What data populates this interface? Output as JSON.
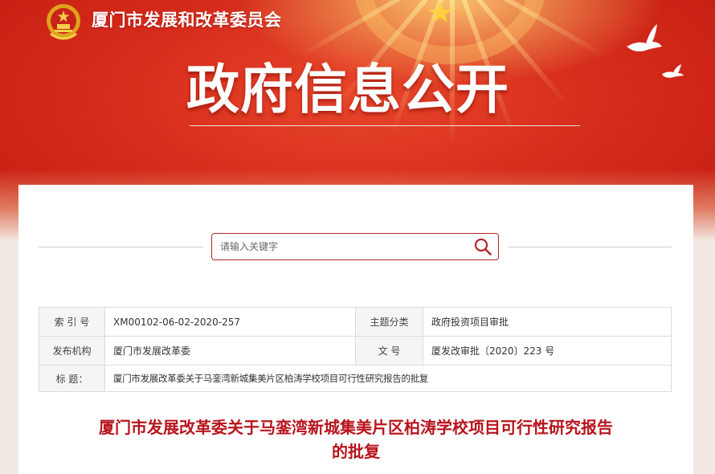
{
  "header": {
    "org_name": "厦门市发展和改革委员会",
    "page_heading": "政府信息公开"
  },
  "search": {
    "placeholder": "请输入关键字"
  },
  "meta": {
    "index_label": "索 引 号",
    "index_value": "XM00102-06-02-2020-257",
    "topic_label": "主题分类",
    "topic_value": "政府投资项目审批",
    "publisher_label": "发布机构",
    "publisher_value": "厦门市发展改革委",
    "docno_label": "文      号",
    "docno_value": "厦发改审批〔2020〕223 号",
    "title_label": "标      题：",
    "title_value": "厦门市发展改革委关于马銮湾新城集美片区柏涛学校项目可行性研究报告的批复"
  },
  "document": {
    "title_line1": "厦门市发展改革委关于马銮湾新城集美片区柏涛学校项目可行性研究报告",
    "title_line2": "的批复"
  },
  "colors": {
    "banner_red": "#d42a1a",
    "accent_red": "#b8141c",
    "border_red": "#b3262a"
  }
}
